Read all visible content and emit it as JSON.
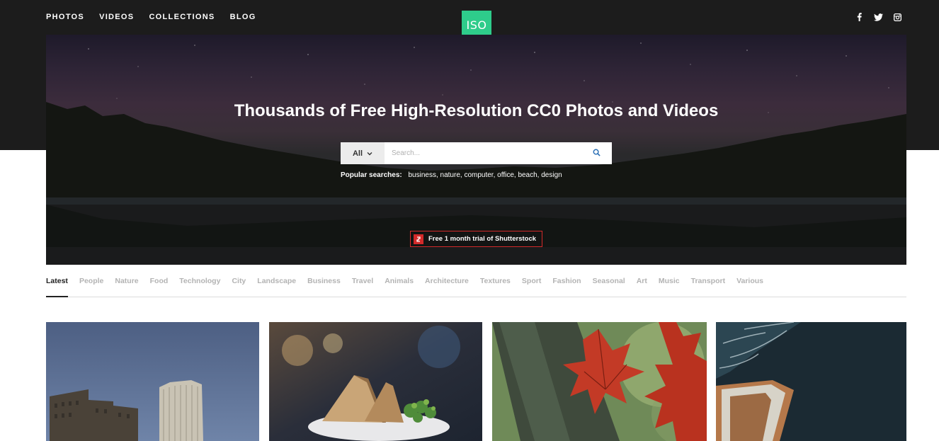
{
  "nav": {
    "items": [
      "PHOTOS",
      "VIDEOS",
      "COLLECTIONS",
      "BLOG"
    ]
  },
  "logo": {
    "text": "ISO",
    "color": "#2ecc8b"
  },
  "social": {
    "icons": [
      "facebook-icon",
      "twitter-icon",
      "instagram-icon"
    ]
  },
  "hero": {
    "title": "Thousands of Free High-Resolution CC0 Photos and Videos",
    "search": {
      "scope": "All",
      "placeholder": "Search..."
    },
    "popular": {
      "label": "Popular searches:",
      "terms": [
        "business,",
        "nature,",
        "computer,",
        "office,",
        "beach,",
        "design"
      ]
    },
    "promo": "Free 1 month trial of Shutterstock"
  },
  "categories": {
    "active": "Latest",
    "items": [
      "Latest",
      "People",
      "Nature",
      "Food",
      "Technology",
      "City",
      "Landscape",
      "Business",
      "Travel",
      "Animals",
      "Architecture",
      "Textures",
      "Sport",
      "Fashion",
      "Seasonal",
      "Art",
      "Music",
      "Transport",
      "Various"
    ]
  },
  "colors": {
    "header_bg": "#1c1c1c",
    "accent": "#2ecc8b",
    "promo_border": "#d32a2a",
    "category_inactive": "#b3b3b3",
    "category_active": "#222222"
  }
}
